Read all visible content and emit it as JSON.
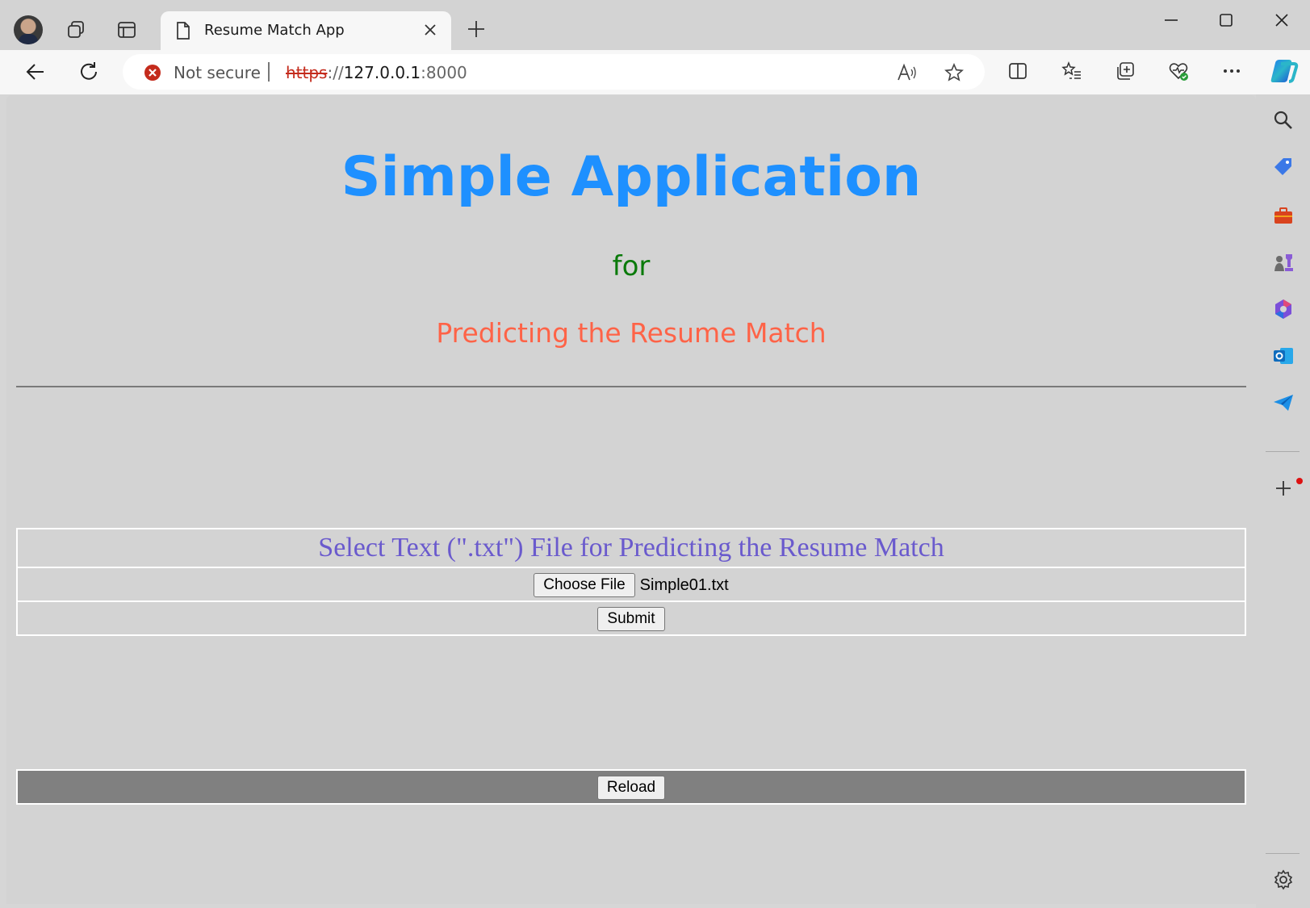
{
  "browser": {
    "tab_title": "Resume Match App",
    "security_label": "Not secure",
    "url_scheme": "https",
    "url_sep": "://",
    "url_host": "127.0.0.1",
    "url_port": ":8000"
  },
  "page": {
    "title": "Simple Application",
    "for_text": "for",
    "subtitle": "Predicting the Resume Match",
    "select_label": "Select Text (\".txt\") File for Predicting the Resume Match",
    "choose_file_label": "Choose File",
    "file_name": "Simple01.txt",
    "submit_label": "Submit",
    "reload_label": "Reload"
  },
  "colors": {
    "title": "#1e90ff",
    "for_text": "#0a7a0a",
    "subtitle": "#ff6347",
    "select_label": "#6a5acd",
    "reload_bar": "#808080"
  },
  "icons": {
    "sidebar": [
      "search-icon",
      "tag-icon",
      "toolbox-icon",
      "chess-icon",
      "copilot-apps-icon",
      "outlook-icon",
      "send-icon",
      "add-icon",
      "settings-icon"
    ]
  }
}
